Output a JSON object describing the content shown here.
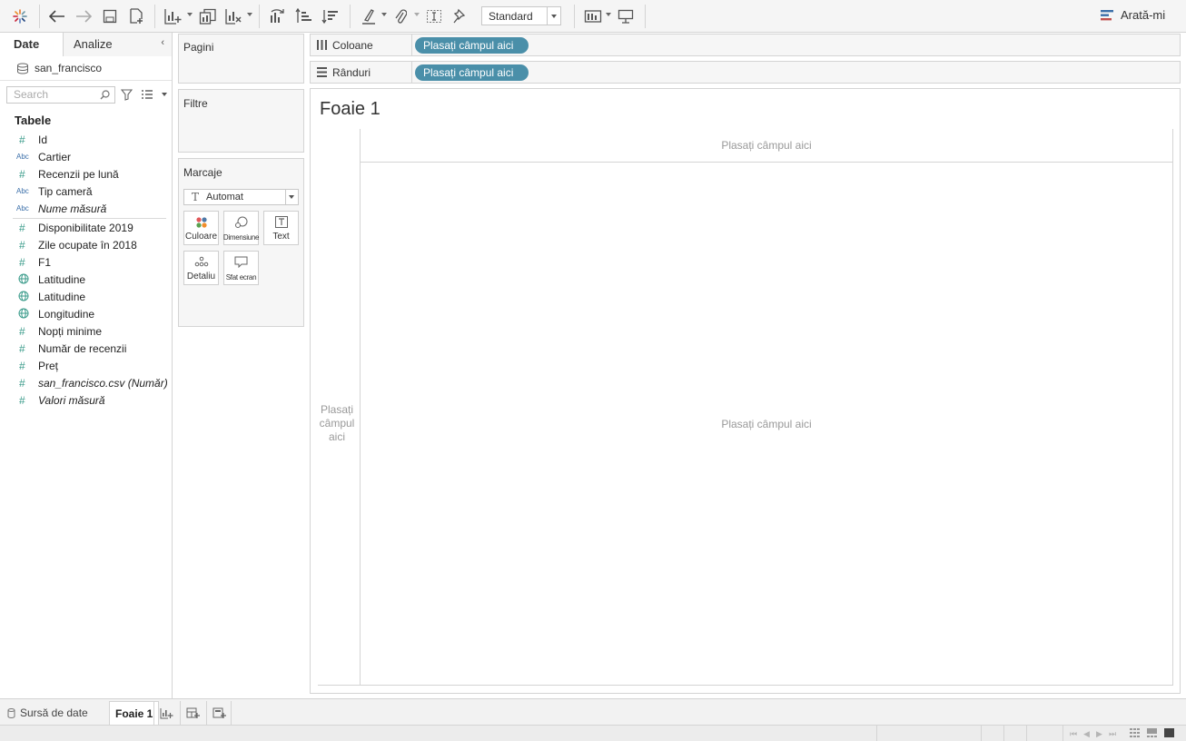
{
  "toolbar": {
    "standard_select": "Standard",
    "show_me_label": "Arată-mi"
  },
  "left_pane": {
    "tabs": {
      "data_label": "Date",
      "analytics_label": "Analize"
    },
    "data_source_name": "san_francisco",
    "search_placeholder": "Search",
    "tables_heading": "Tabele",
    "fields": [
      {
        "name": "Id",
        "icon": "number-icon"
      },
      {
        "name": "Cartier",
        "icon": "abc-icon"
      },
      {
        "name": "Recenzii pe lună",
        "icon": "number-icon"
      },
      {
        "name": "Tip cameră",
        "icon": "abc-icon"
      },
      {
        "name": "Nume măsură",
        "icon": "abc-icon",
        "italic": true
      },
      {
        "name": "Disponibilitate 2019",
        "icon": "number-icon"
      },
      {
        "name": "Zile ocupate în 2018",
        "icon": "number-icon"
      },
      {
        "name": "F1",
        "icon": "number-icon"
      },
      {
        "name": "Latitudine",
        "icon": "globe-icon"
      },
      {
        "name": "Latitudine",
        "icon": "globe-icon"
      },
      {
        "name": "Longitudine",
        "icon": "globe-icon"
      },
      {
        "name": "Nopți minime",
        "icon": "number-icon"
      },
      {
        "name": "Număr de recenzii",
        "icon": "number-icon"
      },
      {
        "name": "Preț",
        "icon": "number-icon"
      },
      {
        "name": "san_francisco.csv (Număr)",
        "icon": "number-icon",
        "italic": true
      },
      {
        "name": "Valori măsură",
        "icon": "number-icon",
        "italic": true
      }
    ]
  },
  "cards": {
    "pages_title": "Pagini",
    "filters_title": "Filtre",
    "marks_title": "Marcaje",
    "marks_type": "Automat",
    "mark_buttons": {
      "color": "Culoare",
      "size": "Dimensiune",
      "text": "Text",
      "detail": "Detaliu",
      "tooltip": "Sfat ecran"
    }
  },
  "shelves": {
    "columns_label": "Coloane",
    "rows_label": "Rânduri",
    "columns_pill": "Plasați câmpul aici",
    "rows_pill": "Plasați câmpul aici"
  },
  "view": {
    "title": "Foaie 1",
    "drop_top": "Plasați câmpul aici",
    "drop_left": "Plasați câmpul aici",
    "drop_center": "Plasați câmpul aici"
  },
  "sheet_tabs": {
    "data_source": "Sursă de date",
    "active_sheet": "Foaie 1"
  },
  "colors": {
    "pill": "#4a8fa9",
    "number_field": "#3a9b8a",
    "dimension_field": "#3b6fa9",
    "show_me_accent": "#3b6fa9"
  }
}
